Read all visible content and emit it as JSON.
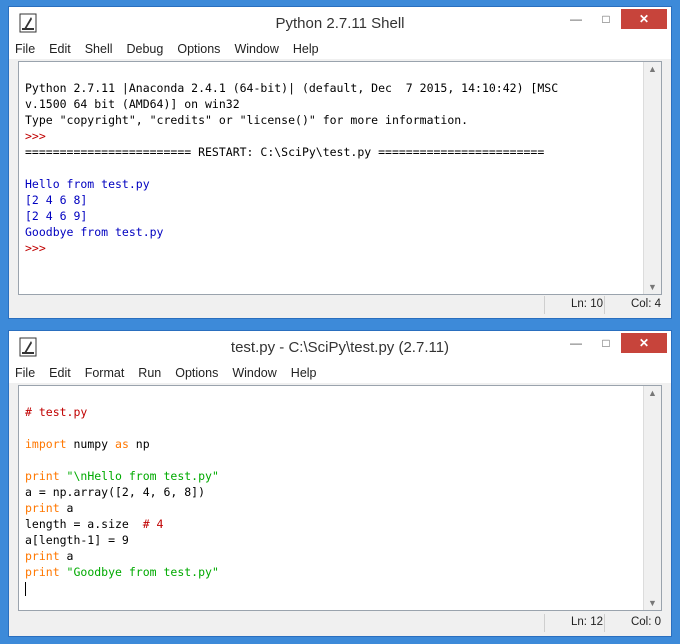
{
  "shell": {
    "title": "Python 2.7.11 Shell",
    "menu": [
      "File",
      "Edit",
      "Shell",
      "Debug",
      "Options",
      "Window",
      "Help"
    ],
    "lines": [
      "Python 2.7.11 |Anaconda 2.4.1 (64-bit)| (default, Dec  7 2015, 14:10:42) [MSC",
      "v.1500 64 bit (AMD64)] on win32",
      "Type \"copyright\", \"credits\" or \"license()\" for more information.",
      ">>> ",
      "======================== RESTART: C:\\SciPy\\test.py ========================",
      "",
      "Hello from test.py",
      "[2 4 6 8]",
      "[2 4 6 9]",
      "Goodbye from test.py",
      ">>> "
    ],
    "status": {
      "ln": "Ln: 10",
      "col": "Col: 4"
    }
  },
  "editor": {
    "title": "test.py - C:\\SciPy\\test.py (2.7.11)",
    "menu": [
      "File",
      "Edit",
      "Format",
      "Run",
      "Options",
      "Window",
      "Help"
    ],
    "code": {
      "l1": "# test.py",
      "l3_kw1": "import",
      "l3_mid": " numpy ",
      "l3_kw2": "as",
      "l3_end": " np",
      "l5_kw": "print",
      "l5_str": " \"\\nHello from test.py\"",
      "l6": "a = np.array([2, 4, 6, 8])",
      "l7_kw": "print",
      "l7_rest": " a",
      "l8_code": "length = a.size  ",
      "l8_comment": "# 4",
      "l9": "a[length-1] = 9",
      "l10_kw": "print",
      "l10_rest": " a",
      "l11_kw": "print",
      "l11_str": " \"Goodbye from test.py\""
    },
    "status": {
      "ln": "Ln: 12",
      "col": "Col: 0"
    }
  },
  "colors": {
    "desktop": "#3d8ad9",
    "output": "#0000c0",
    "prompt": "#c00000",
    "keyword": "#ff7700",
    "string": "#00aa00",
    "comment": "#c00000",
    "close_button": "#c7443b"
  },
  "icons": {
    "app": "idle-feather-icon",
    "minimize": "minimize-icon",
    "maximize": "maximize-icon",
    "close": "close-icon"
  }
}
